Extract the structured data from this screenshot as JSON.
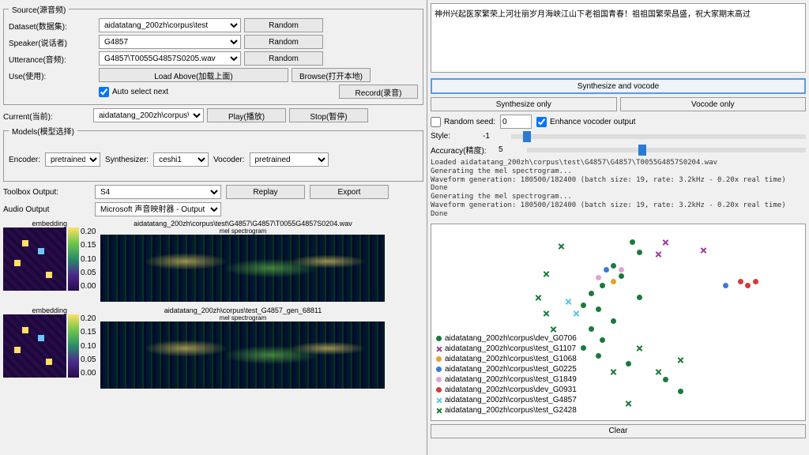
{
  "source": {
    "legend": "Source(源音频)",
    "dataset_label": "Dataset(数据集):",
    "dataset_value": "aidatatang_200zh\\corpus\\test",
    "speaker_label": "Speaker(说话者)",
    "speaker_value": "G4857",
    "utterance_label": "Utterance(音频):",
    "utterance_value": "G4857\\T0055G4857S0205.wav",
    "use_label": "Use(使用):",
    "random_btn": "Random",
    "load_above_btn": "Load Above(加载上面)",
    "browse_btn": "Browse(打开本地)",
    "auto_select_label": "Auto select next",
    "record_btn": "Record(录音)"
  },
  "current": {
    "label": "Current(当前):",
    "value": "aidatatang_200zh\\corpus\\",
    "play_btn": "Play(播放)",
    "stop_btn": "Stop(暂停)"
  },
  "models": {
    "legend": "Models(模型选择)",
    "encoder_label": "Encoder:",
    "encoder_value": "pretrained",
    "synth_label": "Synthesizer:",
    "synth_value": "ceshi1",
    "vocoder_label": "Vocoder:",
    "vocoder_value": "pretrained"
  },
  "output": {
    "toolbox_label": "Toolbox Output:",
    "toolbox_value": "S4",
    "replay_btn": "Replay",
    "export_btn": "Export",
    "audio_label": "Audio Output",
    "audio_value": "Microsoft 声音映射器 - Output"
  },
  "spec1": {
    "embed_title": "embedding",
    "title": "aidatatang_200zh\\corpus\\test\\G4857\\G4857\\T0055G4857S0204.wav",
    "subtitle": "mel spectrogram",
    "cb": [
      "0.20",
      "0.15",
      "0.10",
      "0.05",
      "0.00"
    ]
  },
  "spec2": {
    "embed_title": "embedding",
    "title": "aidatatang_200zh\\corpus\\test_G4857_gen_68811",
    "subtitle": "mel spectrogram",
    "cb": [
      "0.20",
      "0.15",
      "0.10",
      "0.05",
      "0.00"
    ]
  },
  "text_input": "神州兴起医家繁荣上河壮丽岁月海峡江山下老祖国青春！祖祖国繁荣昌盛，祝大家期末高过",
  "synth": {
    "full_btn": "Synthesize and vocode",
    "synth_only": "Synthesize only",
    "vocode_only": "Vocode only"
  },
  "params": {
    "random_seed_label": "Random seed:",
    "random_seed_value": "0",
    "enhance_label": "Enhance vocoder output",
    "style_label": "Style:",
    "style_value": "-1",
    "accuracy_label": "Accuracy(精度):",
    "accuracy_value": "5"
  },
  "log_text": "Loaded aidatatang_200zh\\corpus\\test\\G4857\\G4857\\T0055G4857S0204.wav\nGenerating the mel spectrogram...\nWaveform generation: 180500/182400 (batch size: 19, rate: 3.2kHz - 0.20x real time) Done\nGenerating the mel spectrogram...\nWaveform generation: 180500/182400 (batch size: 19, rate: 3.2kHz - 0.20x real time) Done",
  "legend_items": [
    {
      "color": "#1a7a3a",
      "shape": "dot",
      "label": "aidatatang_200zh\\corpus\\dev_G0706"
    },
    {
      "color": "#9a3a9a",
      "shape": "x",
      "label": "aidatatang_200zh\\corpus\\test_G1107"
    },
    {
      "color": "#e8a030",
      "shape": "dot",
      "label": "aidatatang_200zh\\corpus\\test_G1068"
    },
    {
      "color": "#3a7ad4",
      "shape": "dot",
      "label": "aidatatang_200zh\\corpus\\test_G0225"
    },
    {
      "color": "#e8a0d4",
      "shape": "dot",
      "label": "aidatatang_200zh\\corpus\\test_G1849"
    },
    {
      "color": "#d43a3a",
      "shape": "dot",
      "label": "aidatatang_200zh\\corpus\\dev_G0931"
    },
    {
      "color": "#5ac4e8",
      "shape": "x",
      "label": "aidatatang_200zh\\corpus\\test_G4857"
    },
    {
      "color": "#1a7a3a",
      "shape": "x",
      "label": "aidatatang_200zh\\corpus\\test_G2428"
    }
  ],
  "clear_btn": "Clear",
  "chart_data": {
    "type": "scatter",
    "title": "",
    "xlabel": "",
    "ylabel": "",
    "series": [
      {
        "name": "aidatatang_200zh\\corpus\\dev_G0706",
        "color": "#1a7a3a",
        "marker": "dot",
        "points": [
          [
            53,
            8
          ],
          [
            55,
            13
          ],
          [
            48,
            20
          ],
          [
            50,
            25
          ],
          [
            45,
            30
          ],
          [
            42,
            34
          ],
          [
            55,
            36
          ],
          [
            40,
            40
          ],
          [
            44,
            42
          ],
          [
            48,
            48
          ],
          [
            42,
            52
          ],
          [
            45,
            58
          ],
          [
            40,
            62
          ],
          [
            44,
            66
          ],
          [
            52,
            70
          ],
          [
            62,
            78
          ],
          [
            66,
            84
          ]
        ]
      },
      {
        "name": "aidatatang_200zh\\corpus\\test_G1107",
        "color": "#9a3a9a",
        "marker": "x",
        "points": [
          [
            62,
            8
          ],
          [
            60,
            14
          ],
          [
            72,
            12
          ]
        ]
      },
      {
        "name": "aidatatang_200zh\\corpus\\test_G1068",
        "color": "#e8a030",
        "marker": "dot",
        "points": [
          [
            48,
            28
          ]
        ]
      },
      {
        "name": "aidatatang_200zh\\corpus\\test_G0225",
        "color": "#3a7ad4",
        "marker": "dot",
        "points": [
          [
            78,
            30
          ],
          [
            46,
            22
          ]
        ]
      },
      {
        "name": "aidatatang_200zh\\corpus\\test_G1849",
        "color": "#e8a0d4",
        "marker": "dot",
        "points": [
          [
            44,
            26
          ],
          [
            50,
            22
          ]
        ]
      },
      {
        "name": "aidatatang_200zh\\corpus\\dev_G0931",
        "color": "#d43a3a",
        "marker": "dot",
        "points": [
          [
            82,
            28
          ],
          [
            84,
            30
          ],
          [
            86,
            28
          ]
        ]
      },
      {
        "name": "aidatatang_200zh\\corpus\\test_G4857",
        "color": "#5ac4e8",
        "marker": "x",
        "points": [
          [
            36,
            38
          ],
          [
            38,
            44
          ]
        ]
      },
      {
        "name": "aidatatang_200zh\\corpus\\test_G2428",
        "color": "#1a7a3a",
        "marker": "x",
        "points": [
          [
            34,
            10
          ],
          [
            30,
            24
          ],
          [
            28,
            36
          ],
          [
            30,
            44
          ],
          [
            32,
            52
          ],
          [
            55,
            62
          ],
          [
            60,
            74
          ],
          [
            36,
            82
          ],
          [
            52,
            90
          ],
          [
            66,
            68
          ],
          [
            24,
            58
          ],
          [
            48,
            74
          ]
        ]
      }
    ]
  }
}
